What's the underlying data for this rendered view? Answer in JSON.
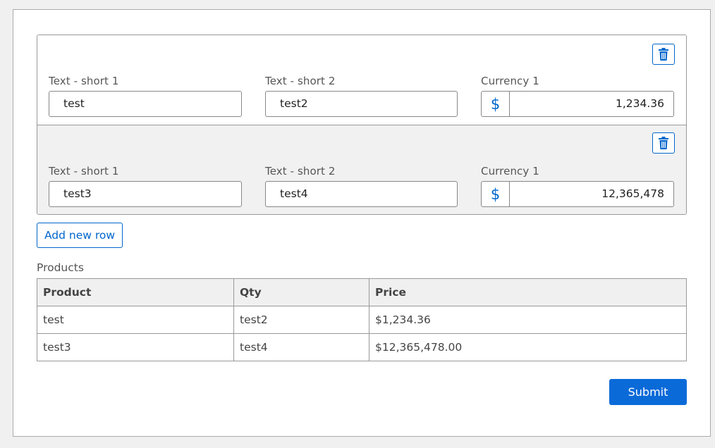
{
  "colors": {
    "accent": "#0066cc",
    "submit_bg": "#0a6ad8"
  },
  "repeater": {
    "add_row_label": "Add new row",
    "delete_icon": "trash-icon",
    "rows": [
      {
        "text_short_1": {
          "label": "Text - short 1",
          "value": "test"
        },
        "text_short_2": {
          "label": "Text - short 2",
          "value": "test2"
        },
        "currency_1": {
          "label": "Currency 1",
          "symbol": "$",
          "value": "1,234.36"
        }
      },
      {
        "text_short_1": {
          "label": "Text - short 1",
          "value": "test3"
        },
        "text_short_2": {
          "label": "Text - short 2",
          "value": "test4"
        },
        "currency_1": {
          "label": "Currency 1",
          "symbol": "$",
          "value": "12,365,478"
        }
      }
    ]
  },
  "products": {
    "title": "Products",
    "columns": [
      "Product",
      "Qty",
      "Price"
    ],
    "rows": [
      [
        "test",
        "test2",
        "$1,234.36"
      ],
      [
        "test3",
        "test4",
        "$12,365,478.00"
      ]
    ]
  },
  "submit_label": "Submit"
}
